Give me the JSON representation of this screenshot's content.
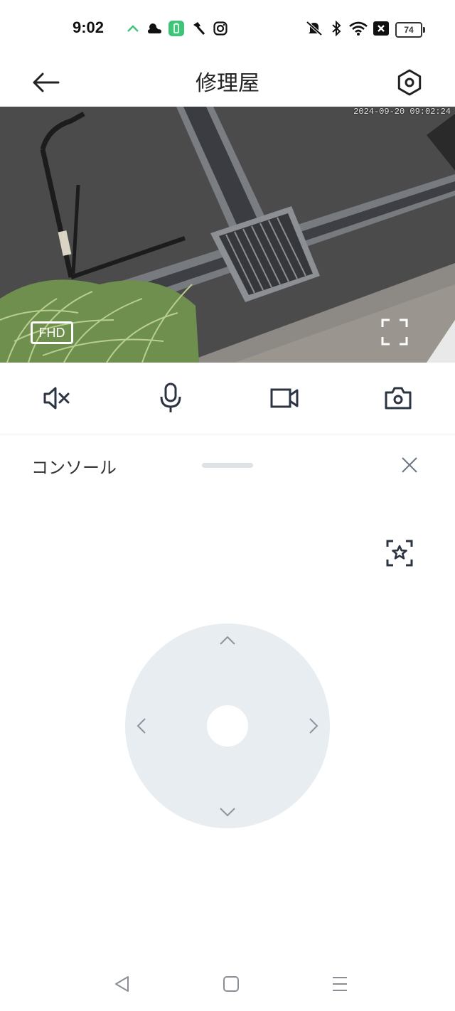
{
  "status_bar": {
    "time": "9:02",
    "left_icons": [
      "arrow-up-app-icon",
      "weather-cloud-icon",
      "battery-app-icon",
      "hammer-icon",
      "instagram-icon"
    ],
    "right_icons": [
      "mute-bell-icon",
      "bluetooth-icon",
      "wifi-icon",
      "x-box-icon"
    ],
    "battery_level": "74"
  },
  "header": {
    "title": "修理屋",
    "back_icon": "back-arrow-icon",
    "settings_icon": "settings-gear-icon"
  },
  "video": {
    "timestamp": "2024-09-20 09:02:24",
    "quality_badge": "FHD",
    "fullscreen_icon": "fullscreen-icon"
  },
  "controls": {
    "items": [
      "mute-icon",
      "microphone-icon",
      "record-video-icon",
      "snapshot-camera-icon"
    ]
  },
  "console": {
    "title": "コンソール",
    "close_icon": "close-icon",
    "favorite_icon": "favorite-position-icon",
    "joystick": {
      "up_icon": "chevron-up-icon",
      "down_icon": "chevron-down-icon",
      "left_icon": "chevron-left-icon",
      "right_icon": "chevron-right-icon"
    }
  },
  "navbar": {
    "items": [
      "nav-back-icon",
      "nav-home-icon",
      "nav-menu-icon"
    ]
  },
  "colors": {
    "accent_green": "#3fc47a",
    "joystick_bg": "#e8edf1",
    "divider": "#eceff1"
  }
}
